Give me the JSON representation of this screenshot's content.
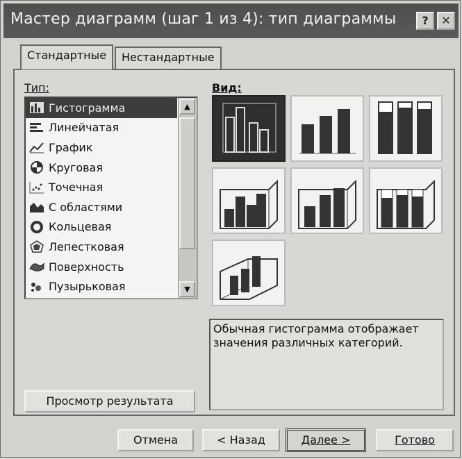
{
  "window": {
    "title": "Мастер диаграмм (шаг 1 из 4): тип диаграммы",
    "help_label": "?",
    "close_label": "✕"
  },
  "tabs": [
    {
      "label": "Стандартные",
      "active": true
    },
    {
      "label": "Нестандартные",
      "active": false
    }
  ],
  "type_list": {
    "label": "Тип:",
    "items": [
      {
        "label": "Гистограмма",
        "icon": "column-chart-icon",
        "selected": true
      },
      {
        "label": "Линейчатая",
        "icon": "bar-chart-icon"
      },
      {
        "label": "График",
        "icon": "line-chart-icon"
      },
      {
        "label": "Круговая",
        "icon": "pie-chart-icon"
      },
      {
        "label": "Точечная",
        "icon": "scatter-chart-icon"
      },
      {
        "label": "С областями",
        "icon": "area-chart-icon"
      },
      {
        "label": "Кольцевая",
        "icon": "doughnut-chart-icon"
      },
      {
        "label": "Лепестковая",
        "icon": "radar-chart-icon"
      },
      {
        "label": "Поверхность",
        "icon": "surface-chart-icon"
      },
      {
        "label": "Пузырьковая",
        "icon": "bubble-chart-icon"
      }
    ]
  },
  "subtype": {
    "label": "Вид:",
    "selected_index": 0,
    "variants": [
      "clustered-column",
      "stacked-column",
      "100-stacked-column",
      "clustered-3d",
      "stacked-3d",
      "100-stacked-3d",
      "3d-column"
    ]
  },
  "description": "Обычная гистограмма отображает значения различных категорий.",
  "preview_button": "Просмотр результата",
  "buttons": {
    "cancel": "Отмена",
    "back": "< Назад",
    "next": "Далее >",
    "finish": "Готово"
  },
  "colors": {
    "selection": "#3d3d3d",
    "bars": "#333333"
  }
}
